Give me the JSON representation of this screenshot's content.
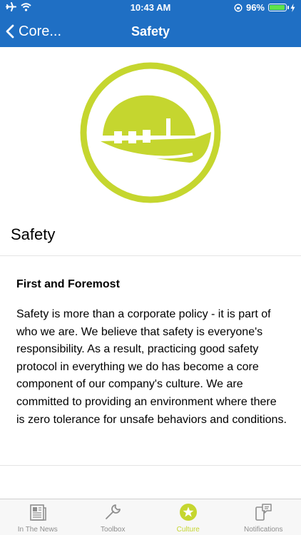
{
  "status_bar": {
    "time": "10:43 AM",
    "battery_percent": "96%",
    "battery_level": 0.96,
    "icons": [
      "airplane-icon",
      "wifi-icon",
      "rotation-lock-icon",
      "battery-icon",
      "charging-icon"
    ]
  },
  "nav": {
    "back_label": "Core...",
    "title": "Safety"
  },
  "hero": {
    "icon": "hard-hat-icon",
    "color": "#c5d62f"
  },
  "section": {
    "title": "Safety"
  },
  "card": {
    "heading": "First and Foremost",
    "body": "Safety is more than a corporate policy - it is part of who we are. We believe that safety is everyone's responsibility. As a result, practicing good safety protocol in everything we do has become a core component of our company's culture. We are committed to providing an environment where there is zero tolerance for unsafe behaviors and conditions."
  },
  "tabs": [
    {
      "label": "In The News",
      "icon": "newspaper-icon",
      "active": false
    },
    {
      "label": "Toolbox",
      "icon": "wrench-icon",
      "active": false
    },
    {
      "label": "Culture",
      "icon": "star-icon",
      "active": true
    },
    {
      "label": "Notifications",
      "icon": "notifications-icon",
      "active": false
    }
  ],
  "colors": {
    "header": "#1f6fc4",
    "accent": "#c5d62f",
    "tab_inactive": "#8e8e8e"
  }
}
